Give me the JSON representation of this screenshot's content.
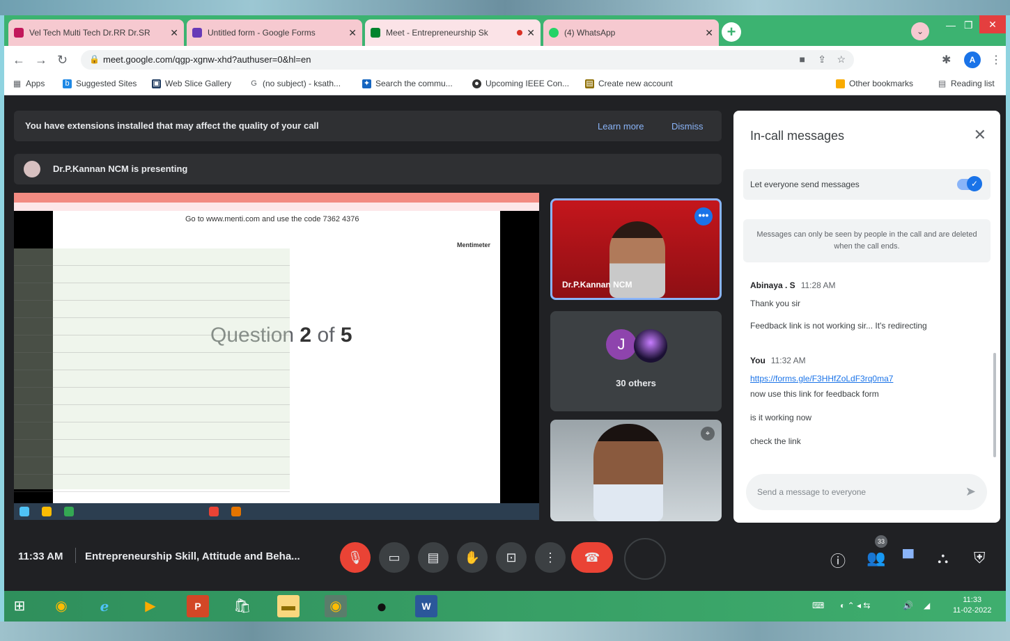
{
  "browser": {
    "tabs": [
      {
        "title": "Vel Tech Multi Tech Dr.RR Dr.SR",
        "close": "✕"
      },
      {
        "title": "Untitled form - Google Forms",
        "close": "✕"
      },
      {
        "title": "Meet - Entrepreneurship Sk",
        "close": "✕"
      },
      {
        "title": "(4) WhatsApp",
        "close": "✕"
      }
    ],
    "new_tab": "+",
    "url": "meet.google.com/qgp-xgnw-xhd?authuser=0&hl=en",
    "profile_initial": "A",
    "bookmarks": [
      "Apps",
      "Suggested Sites",
      "Web Slice Gallery",
      "(no subject) - ksath...",
      "Search the commu...",
      "Upcoming IEEE Con...",
      "Create new account"
    ],
    "other_bookmarks": "Other bookmarks",
    "reading_list": "Reading list"
  },
  "meet": {
    "banner_text": "You have extensions installed that may affect the quality of your call",
    "learn_more": "Learn more",
    "dismiss": "Dismiss",
    "presenter_text": "Dr.P.Kannan NCM is presenting",
    "shared": {
      "code_text": "Go to www.menti.com and use the code 7362 4376",
      "brand": "Mentimeter",
      "question_prefix": "Question",
      "question_num": "2",
      "question_of": "of",
      "question_total": "5"
    },
    "tiles": {
      "presenter_name": "Dr.P.Kannan NCM",
      "others_initial": "J",
      "others_label": "30 others"
    },
    "chat": {
      "title": "In-call messages",
      "toggle_label": "Let everyone send messages",
      "info": "Messages can only be seen by people in the call and are deleted when the call ends.",
      "messages": [
        {
          "sender": "Abinaya . S",
          "time": "11:28 AM",
          "lines": [
            "Thank you sir",
            "Feedback link is not working sir... It's redirecting"
          ]
        },
        {
          "sender": "You",
          "time": "11:32 AM",
          "link": "https://forms.gle/F3HHfZoLdF3rq0ma7",
          "lines": [
            "now use this link for feedback form",
            "is it working now",
            "check the link"
          ]
        }
      ],
      "input_placeholder": "Send a message to everyone"
    },
    "bottom": {
      "time": "11:33 AM",
      "meeting_title": "Entrepreneurship Skill, Attitude and Beha...",
      "participants_badge": "33"
    }
  },
  "taskbar": {
    "clock_time": "11:33",
    "clock_date": "11-02-2022"
  }
}
